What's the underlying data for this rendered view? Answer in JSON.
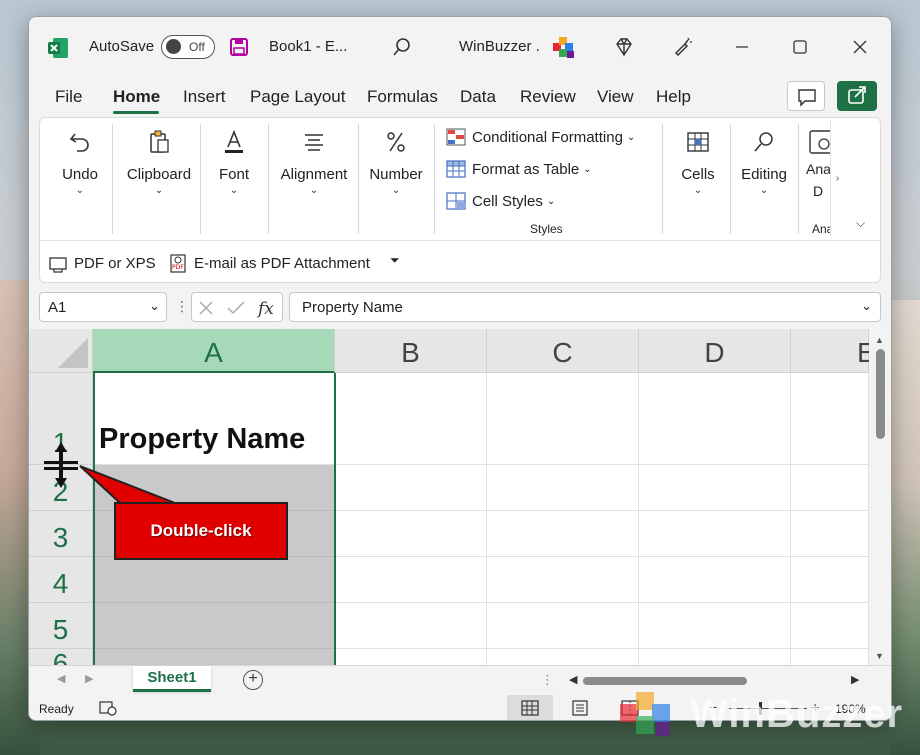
{
  "titlebar": {
    "autosave_label": "AutoSave",
    "autosave_state": "Off",
    "document_title": "Book1  -  E...",
    "account_name": "WinBuzzer ."
  },
  "menu": {
    "tabs": [
      "File",
      "Home",
      "Insert",
      "Page Layout",
      "Formulas",
      "Data",
      "Review",
      "View",
      "Help"
    ],
    "active_tab": "Home"
  },
  "ribbon": {
    "undo": "Undo",
    "clipboard": "Clipboard",
    "font": "Font",
    "alignment": "Alignment",
    "number": "Number",
    "conditional_formatting": "Conditional Formatting",
    "format_as_table": "Format as Table",
    "cell_styles": "Cell Styles",
    "styles_group": "Styles",
    "cells": "Cells",
    "editing": "Editing",
    "analyze_partial": "Ana D",
    "analyze_group_partial": "Ana"
  },
  "quick_access": {
    "pdf_xps": "PDF or XPS",
    "email_pdf": "E-mail as PDF Attachment"
  },
  "formula_bar": {
    "name_box": "A1",
    "formula_value": "Property Name"
  },
  "grid": {
    "columns": [
      "A",
      "B",
      "C",
      "D",
      "E"
    ],
    "rows": [
      "1",
      "2",
      "3",
      "4",
      "5",
      "6"
    ],
    "a1_value": "Property Name",
    "selected_column": "A"
  },
  "sheets": {
    "active": "Sheet1"
  },
  "status": {
    "ready": "Ready",
    "zoom": "190%"
  },
  "annotation": {
    "callout_text": "Double-click"
  },
  "watermark": {
    "text": "WinBuzzer"
  },
  "colors": {
    "excel_green": "#1e7145",
    "selected_header": "#a6d9b8",
    "callout_red": "#e10000"
  }
}
